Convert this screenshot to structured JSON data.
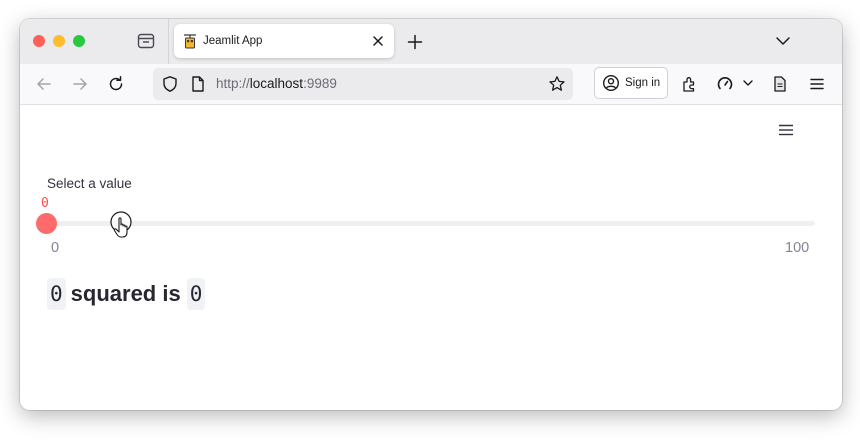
{
  "browser": {
    "tab_title": "Jeamlit App",
    "url": {
      "scheme": "http://",
      "host": "localhost",
      "port": ":9989"
    },
    "signin_label": "Sign in"
  },
  "app": {
    "slider": {
      "label": "Select a value",
      "value": "0",
      "min_label": "0",
      "max_label": "100",
      "min": 0,
      "max": 100,
      "current": 0
    },
    "result": {
      "input": "0",
      "text": "squared is",
      "output": "0"
    }
  },
  "colors": {
    "accent": "#ff4b4b",
    "thumb": "#ff6b6b",
    "track": "#efeff2"
  },
  "icons": [
    "tab-overview-icon",
    "app-favicon",
    "close-icon",
    "plus-icon",
    "chevron-down-icon",
    "back-arrow-icon",
    "forward-arrow-icon",
    "reload-icon",
    "shield-icon",
    "page-icon",
    "star-icon",
    "account-icon",
    "extensions-icon",
    "speedometer-icon",
    "reader-icon",
    "menu-icon",
    "hand-cursor-icon"
  ]
}
